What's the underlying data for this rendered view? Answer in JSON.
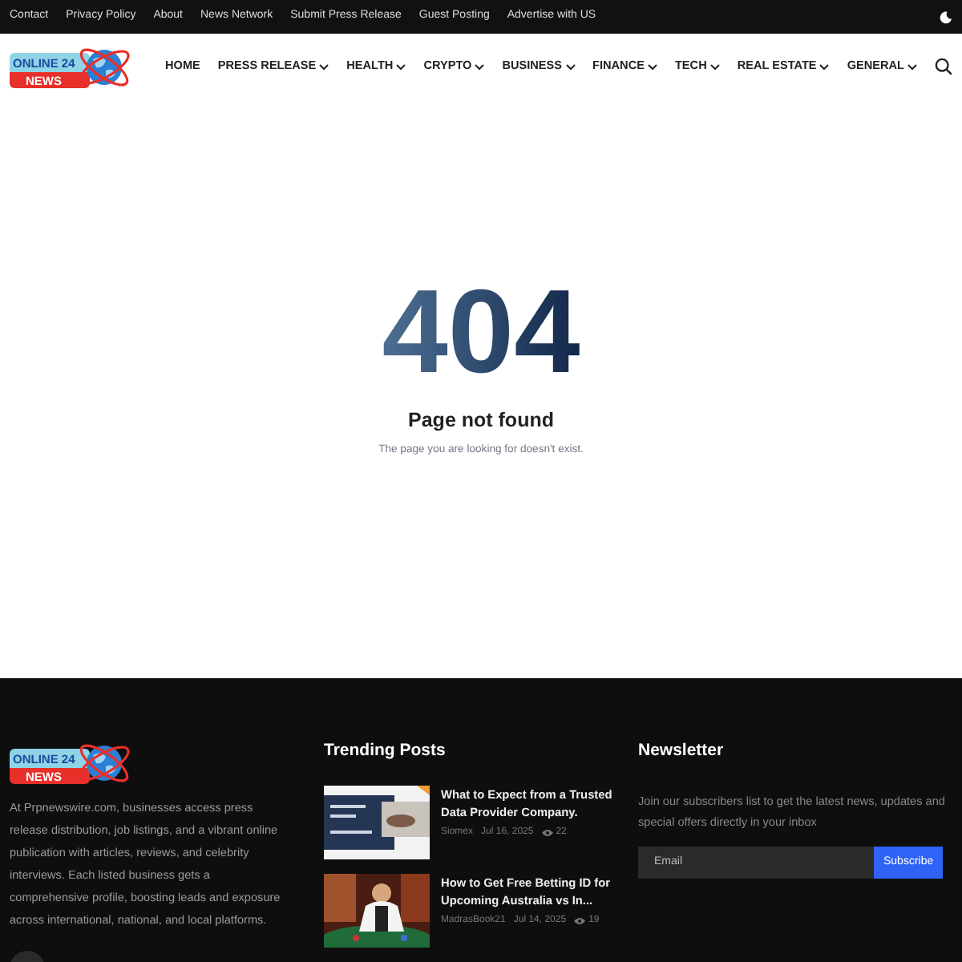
{
  "top_bar": {
    "links": [
      "Contact",
      "Privacy Policy",
      "About",
      "News Network",
      "Submit Press Release",
      "Guest Posting",
      "Advertise with US"
    ]
  },
  "logo": {
    "line_1": "ONLINE 24",
    "line_2": "NEWS"
  },
  "nav": [
    {
      "label": "HOME",
      "dropdown": false
    },
    {
      "label": "PRESS RELEASE",
      "dropdown": true
    },
    {
      "label": "HEALTH",
      "dropdown": true
    },
    {
      "label": "CRYPTO",
      "dropdown": true
    },
    {
      "label": "BUSINESS",
      "dropdown": true
    },
    {
      "label": "FINANCE",
      "dropdown": true
    },
    {
      "label": "TECH",
      "dropdown": true
    },
    {
      "label": "REAL ESTATE",
      "dropdown": true
    },
    {
      "label": "GENERAL",
      "dropdown": true
    }
  ],
  "error": {
    "code": "404",
    "title": "Page not found",
    "message": "The page you are looking for doesn't exist."
  },
  "footer": {
    "logo": {
      "line_1": "ONLINE 24",
      "line_2": "NEWS"
    },
    "about": "At Prpnewswire.com, businesses access press release distribution, job listings, and a vibrant online publication with articles, reviews, and celebrity interviews. Each listed business gets a comprehensive profile, boosting leads and exposure across international, national, and local platforms.",
    "trending": {
      "title": "Trending Posts",
      "posts": [
        {
          "title": "What to Expect from a Trusted Data Provider Company.",
          "author": "Siomex",
          "date": "Jul 16, 2025",
          "views": "22"
        },
        {
          "title": "How to Get Free Betting ID for Upcoming Australia vs In...",
          "author": "MadrasBook21",
          "date": "Jul 14, 2025",
          "views": "19"
        }
      ]
    },
    "newsletter": {
      "title": "Newsletter",
      "text": "Join our subscribers list to get the latest news, updates and special offers directly in your inbox",
      "placeholder": "Email",
      "button": "Subscribe"
    }
  }
}
